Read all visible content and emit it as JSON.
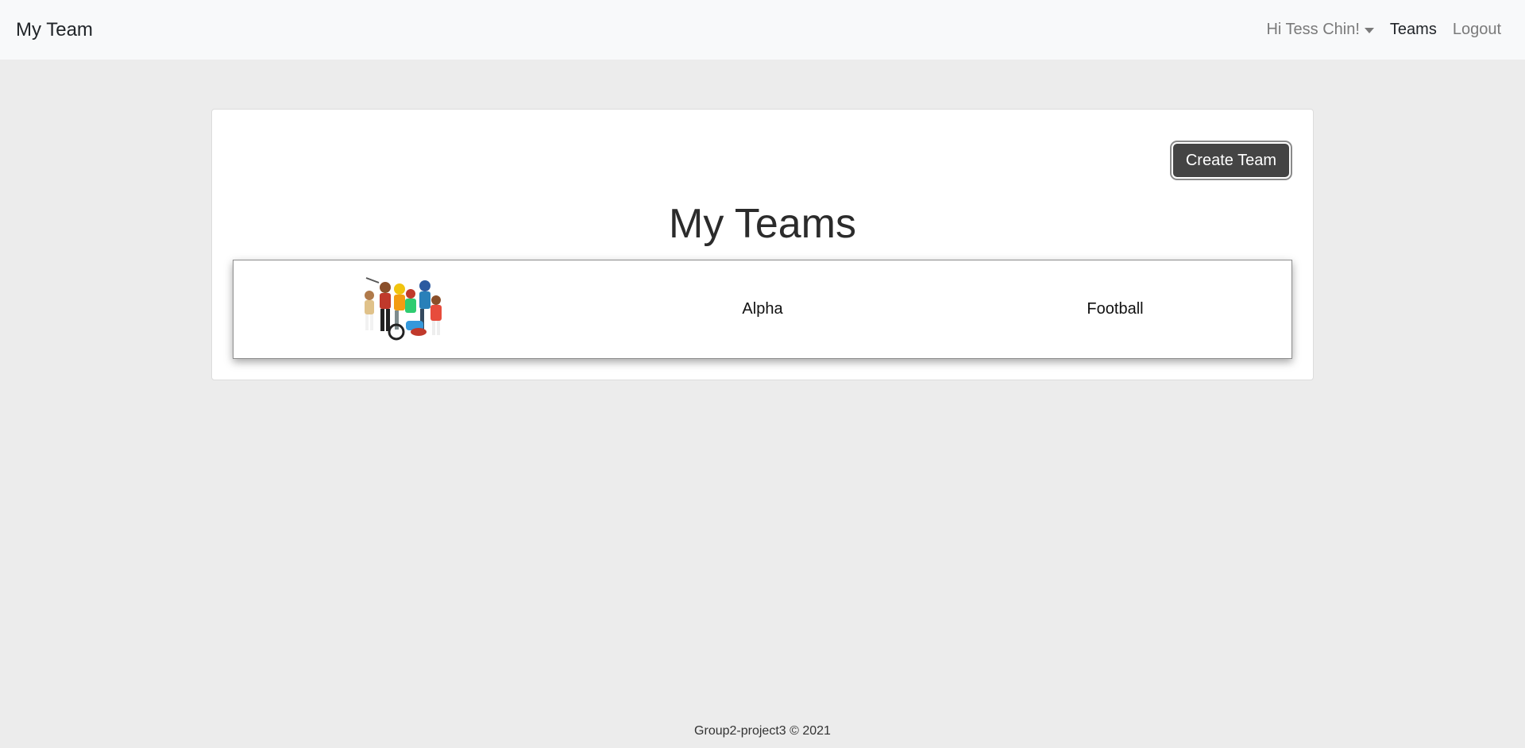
{
  "navbar": {
    "brand": "My Team",
    "user_menu": "Hi Tess Chin!",
    "teams_link": "Teams",
    "logout_link": "Logout"
  },
  "main": {
    "create_button": "Create Team",
    "title": "My Teams",
    "teams": [
      {
        "image_icon": "team-mascots-image",
        "name": "Alpha",
        "sport": "Football"
      }
    ]
  },
  "footer": {
    "text": "Group2-project3 © 2021"
  },
  "colors": {
    "navbar_bg": "#f8f9fa",
    "page_bg": "#ececec",
    "button_bg": "#444444"
  }
}
